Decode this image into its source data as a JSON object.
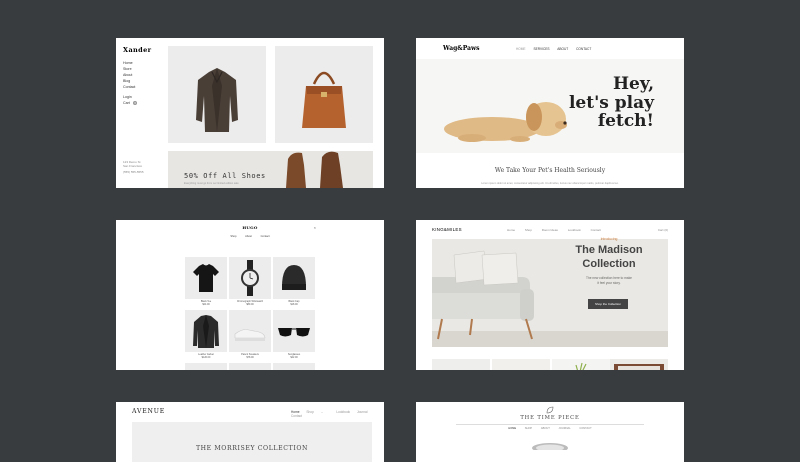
{
  "card1": {
    "brand": "Xander",
    "nav": [
      "Home",
      "Store",
      "About",
      "Blog",
      "Contact"
    ],
    "login": "Login",
    "cart": "Cart",
    "cart_count": "0",
    "footer": [
      "123 Demo St",
      "San Francisco",
      "(555) 555-5555"
    ],
    "promo_title": "50% Off All Shoes",
    "promo_sub": "Everything must go from our limited edition sale"
  },
  "card2": {
    "logo": "Wag&Paws",
    "menu": [
      "HOME",
      "SERVICES",
      "ABOUT",
      "CONTACT"
    ],
    "headline": [
      "Hey,",
      "let's play",
      "fetch!"
    ],
    "subtitle": "We Take Your Pet's Health Seriously",
    "body": "Lorem ipsum dolor sit amet, consectetur adipiscing elit. Ut elit tellus, luctus nec ullamcorper mattis, pulvinar dapibus leo."
  },
  "card3": {
    "logo": "HUGO",
    "menu": [
      "Shop",
      "About",
      "Contact"
    ],
    "close": "×",
    "products": [
      {
        "name": "Black Tee",
        "price": "$24.00"
      },
      {
        "name": "Chronograph Wristwatch",
        "price": "$89.00"
      },
      {
        "name": "Black Cap",
        "price": "$18.00"
      },
      {
        "name": "Leather Jacket",
        "price": "$120.00"
      },
      {
        "name": "Patent Sneakers",
        "price": "$78.00"
      },
      {
        "name": "Sunglasses",
        "price": "$42.00"
      }
    ]
  },
  "card4": {
    "logo": "KING&MILES",
    "menu": [
      "Home",
      "Shop",
      "Room Ideas",
      "Lookbook",
      "Contact"
    ],
    "cart": "Cart (0)",
    "intro": "Introducing",
    "headline": [
      "The Madison",
      "Collection"
    ],
    "desc": [
      "The new collection here to make",
      "it feel your story."
    ],
    "button": "Shop the Collection"
  },
  "card5": {
    "logo": "AVENUE",
    "menu": [
      "Home",
      "Shop",
      "Lookbook",
      "Journal",
      "Contact"
    ],
    "hero_title": "THE MORRISEY COLLECTION"
  },
  "card6": {
    "logo": "THE TIME PIECE",
    "menu": [
      "HOME",
      "SHOP",
      "ABOUT",
      "JOURNAL",
      "CONTACT"
    ]
  }
}
